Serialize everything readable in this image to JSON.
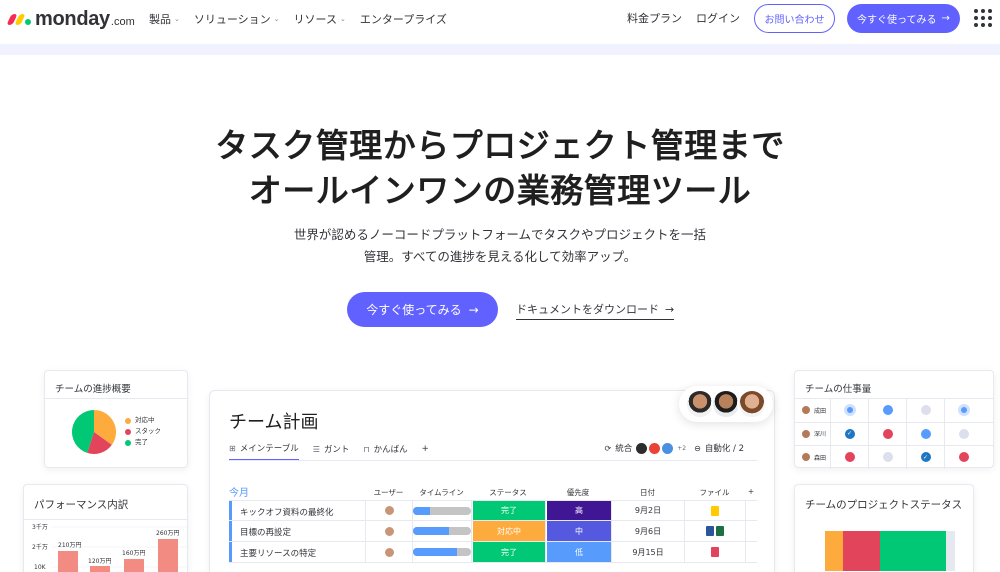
{
  "nav": {
    "logo_word": "monday",
    "logo_suffix": ".com",
    "menu": [
      {
        "label": "製品",
        "dropdown": true
      },
      {
        "label": "ソリューション",
        "dropdown": true
      },
      {
        "label": "リソース",
        "dropdown": true
      },
      {
        "label": "エンタープライズ",
        "dropdown": false
      }
    ],
    "pricing": "料金プラン",
    "login": "ログイン",
    "contact": "お問い合わせ",
    "cta": "今すぐ使ってみる",
    "cta_arrow": "→"
  },
  "hero": {
    "title_line1": "タスク管理からプロジェクト管理まで",
    "title_line2": "オールインワンの業務管理ツール",
    "sub_line1": "世界が認めるノーコードプラットフォームでタスクやプロジェクトを一括",
    "sub_line2": "管理。すべての進捗を見える化して効率アップ。",
    "cta": "今すぐ使ってみる",
    "cta_arrow": "→",
    "download": "ドキュメントをダウンロード",
    "download_arrow": "→"
  },
  "progress_card": {
    "title": "チームの進捗概要",
    "legend": [
      {
        "label": "対応中",
        "color": "#fdab3d"
      },
      {
        "label": "スタック",
        "color": "#e2445c"
      },
      {
        "label": "完了",
        "color": "#00c875"
      }
    ],
    "pie": [
      {
        "label": "対応中",
        "value": 35,
        "color": "#fdab3d"
      },
      {
        "label": "スタック",
        "value": 20,
        "color": "#e2445c"
      },
      {
        "label": "完了",
        "value": 45,
        "color": "#00c875"
      }
    ]
  },
  "perf_card": {
    "title": "パフォーマンス内訳",
    "y_ticks": [
      "3千万",
      "2千万",
      "10K"
    ],
    "bar_labels": [
      "210万円",
      "120万円",
      "160万円",
      "260万円"
    ]
  },
  "workload_card": {
    "title": "チームの仕事量",
    "rows": [
      {
        "name": "成田",
        "cells": [
          "blue-small",
          "blue",
          "grey",
          "blue-small"
        ]
      },
      {
        "name": "深川",
        "cells": [
          "blue-check",
          "red",
          "blue",
          "grey"
        ]
      },
      {
        "name": "森田",
        "cells": [
          "red",
          "grey",
          "blue-check",
          "red"
        ]
      }
    ]
  },
  "status_card": {
    "title": "チームのプロジェクトステータス",
    "segments": [
      {
        "value": 8,
        "color": "#fdab3d"
      },
      {
        "value": 17,
        "color": "#e2445c"
      },
      {
        "value": 30,
        "color": "#00c875"
      },
      {
        "value": 4,
        "color": "#e6e9ef"
      }
    ]
  },
  "board": {
    "title": "チーム計画",
    "views": [
      {
        "label": "メインテーブル",
        "icon": "⊞",
        "active": true
      },
      {
        "label": "ガント",
        "icon": "☰",
        "active": false
      },
      {
        "label": "かんばん",
        "icon": "⊓",
        "active": false
      },
      {
        "label": "+",
        "icon": "",
        "active": false
      }
    ],
    "integrations_label": "統合",
    "integrations_count": "+2",
    "automation_label": "自動化 / 2",
    "group": "今月",
    "columns": [
      "ユーザー",
      "タイムライン",
      "ステータス",
      "優先度",
      "日付",
      "ファイル",
      "+"
    ],
    "rows": [
      {
        "name": "キックオフ資料の最終化",
        "timeline": 0.3,
        "status": "完了",
        "status_color": "#00c875",
        "priority": "高",
        "priority_color": "#401694",
        "date": "9月2日",
        "files": [
          "#ffcb00"
        ]
      },
      {
        "name": "目標の再設定",
        "timeline": 0.62,
        "status": "対応中",
        "status_color": "#fdab3d",
        "priority": "中",
        "priority_color": "#5559df",
        "date": "9月6日",
        "files": [
          "#2b579a",
          "#1d7044"
        ]
      },
      {
        "name": "主要リソースの特定",
        "timeline": 0.75,
        "status": "完了",
        "status_color": "#00c875",
        "priority": "低",
        "priority_color": "#579bfc",
        "date": "9月15日",
        "files": [
          "#e2445c"
        ]
      }
    ]
  },
  "colors": {
    "brand": "#6161ff",
    "band": "#f0f3ff",
    "group": "#579bfc"
  }
}
